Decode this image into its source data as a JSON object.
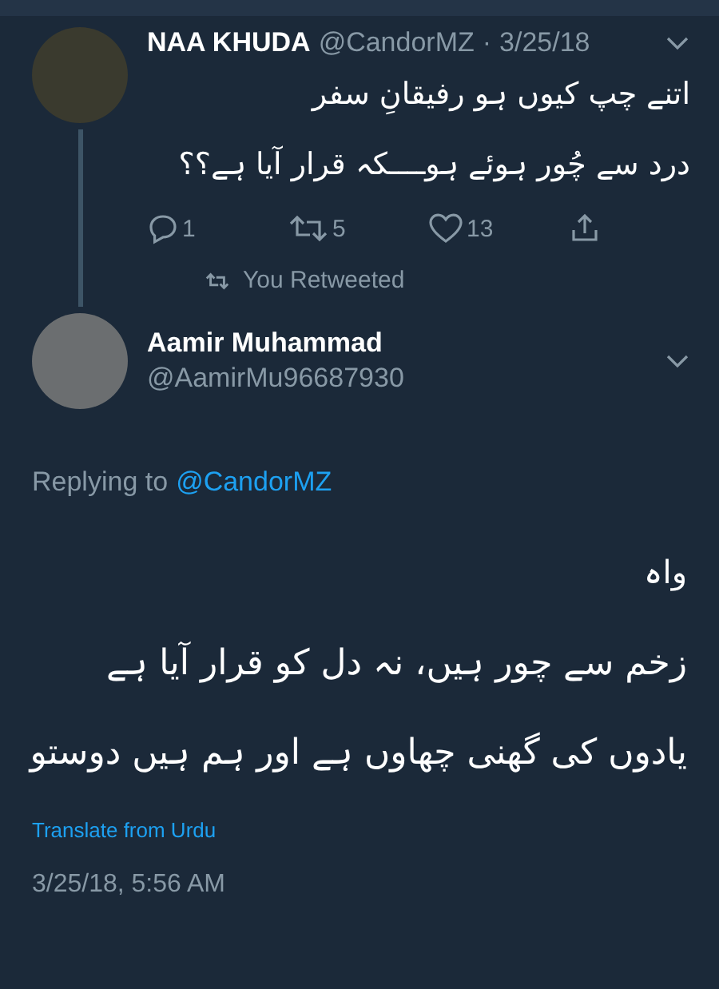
{
  "parent_tweet": {
    "name": "NAA KHUDA",
    "handle": "@CandorMZ",
    "separator": "·",
    "date": "3/25/18",
    "lines": [
      "اتنے چپ کیوں ہو رفیقانِ سفر",
      "درد سے چُور ہوئے ہوــــکہ قرار آیا ہے؟؟"
    ],
    "reply_count": "1",
    "retweet_count": "5",
    "like_count": "13"
  },
  "retweet_notice": "You Retweeted",
  "reply_tweet": {
    "name": "Aamir Muhammad",
    "handle": "@AamirMu96687930",
    "replying_to": "Replying to",
    "replying_handle": "@CandorMZ",
    "lines": [
      {
        "kind": "small",
        "text": "واہ"
      },
      {
        "kind": "large",
        "text": "زخم سے چور ہیں، نہ دل کو قرار آیا ہے"
      },
      {
        "kind": "large",
        "text": "یادوں کی گھنی چھاوں ہے اور ہم ہیں دوستو"
      }
    ],
    "translate": "Translate from Urdu",
    "timestamp": "3/25/18, 5:56 AM"
  }
}
